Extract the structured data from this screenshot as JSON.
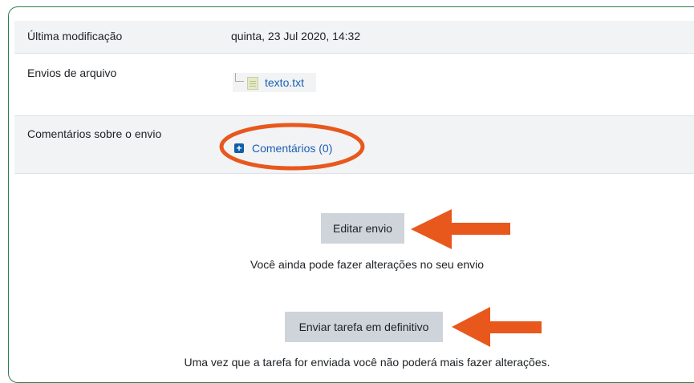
{
  "submission": {
    "last_modified_label": "Última modificação",
    "last_modified_value": "quinta, 23 Jul 2020, 14:32",
    "file_submissions_label": "Envios de arquivo",
    "file_name": "texto.txt",
    "comments_label": "Comentários sobre o envio",
    "comments_link": "Comentários (0)"
  },
  "actions": {
    "edit_button": "Editar envio",
    "edit_hint": "Você ainda pode fazer alterações no seu envio",
    "submit_button": "Enviar tarefa em definitivo",
    "submit_hint": "Uma vez que a tarefa for enviada você não poderá mais fazer alterações."
  },
  "colors": {
    "annotation": "#e8581c",
    "link": "#1a5fb4",
    "frame": "#2e7d4f"
  },
  "icons": {
    "file": "text-file-icon",
    "expand": "plus-square-icon"
  }
}
